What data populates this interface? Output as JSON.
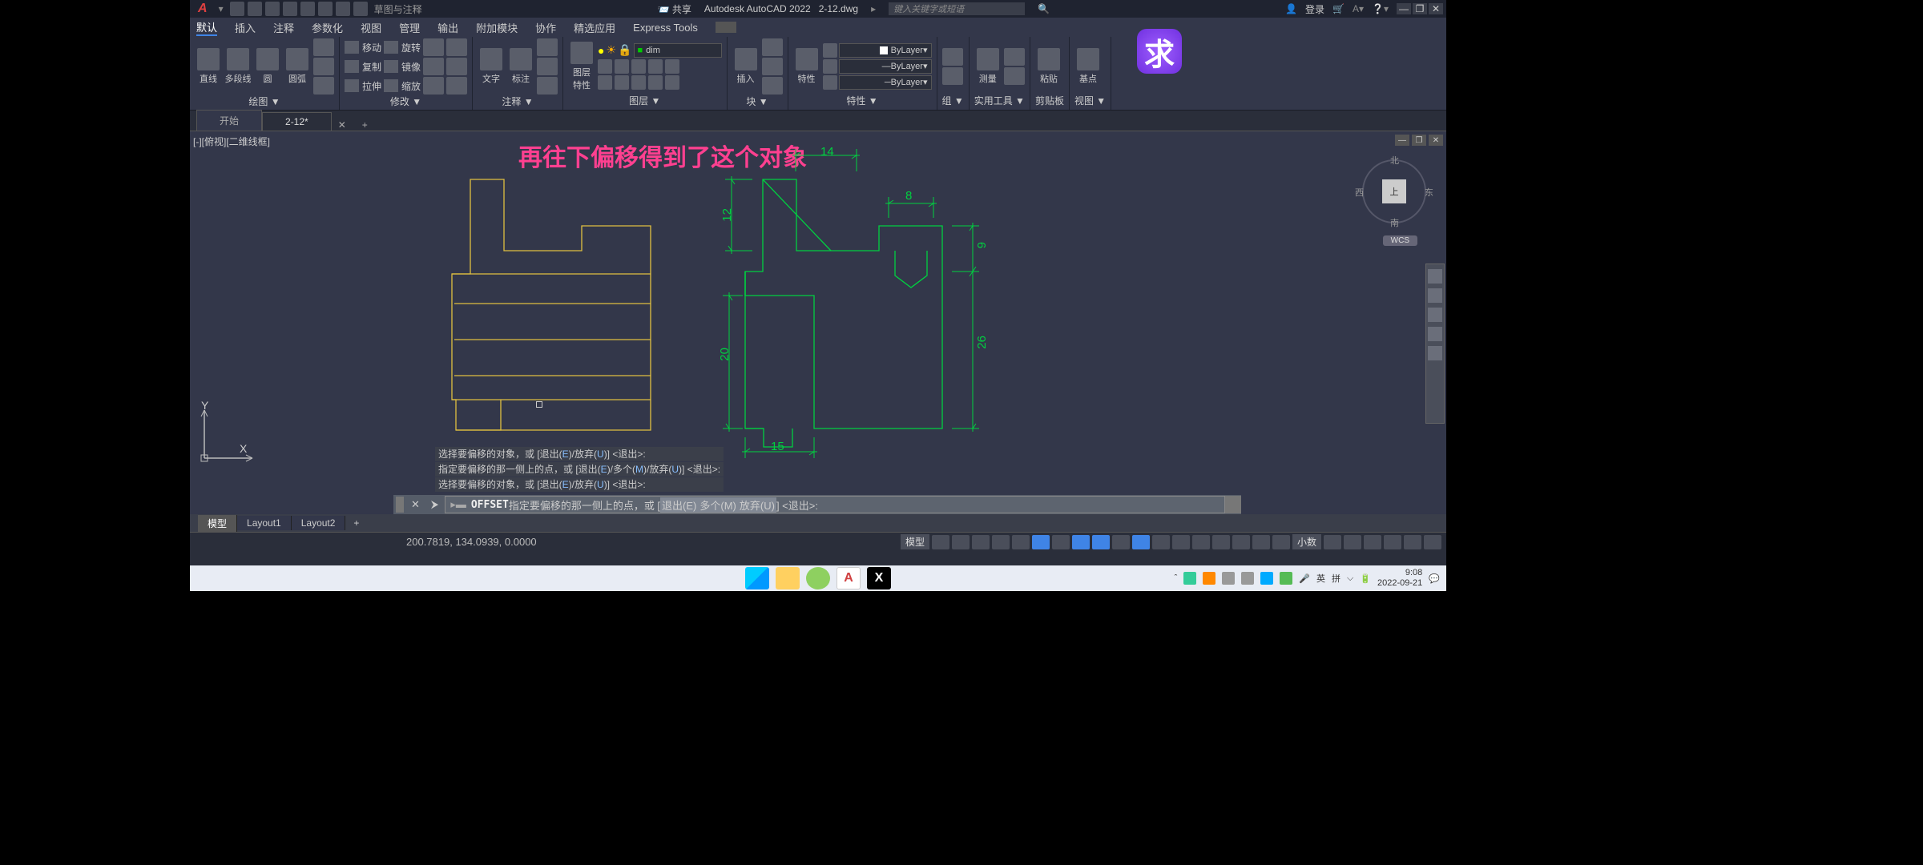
{
  "titlebar": {
    "logo": "A",
    "workspace": "草图与注释",
    "share": "共享",
    "app_title": "Autodesk AutoCAD 2022",
    "filename": "2-12.dwg",
    "search_placeholder": "键入关键字或短语",
    "login": "登录",
    "min": "—",
    "max": "❐",
    "close": "✕"
  },
  "ribbon_tabs": {
    "t0": "默认",
    "t1": "插入",
    "t2": "注释",
    "t3": "参数化",
    "t4": "视图",
    "t5": "管理",
    "t6": "输出",
    "t7": "附加模块",
    "t8": "协作",
    "t9": "精选应用",
    "t10": "Express Tools"
  },
  "panels": {
    "draw": {
      "label": "绘图 ▼",
      "line": "直线",
      "polyline": "多段线",
      "circle": "圆",
      "arc": "圆弧"
    },
    "modify": {
      "label": "修改 ▼",
      "move": "移动",
      "copy": "复制",
      "stretch": "拉伸",
      "rotate": "旋转",
      "mirror": "镜像",
      "scale": "缩放"
    },
    "annot": {
      "label": "注释 ▼",
      "text": "文字",
      "dim": "标注"
    },
    "layer": {
      "label": "图层 ▼",
      "props": "图层\n特性",
      "current": "dim"
    },
    "block": {
      "label": "块 ▼",
      "insert": "插入"
    },
    "props": {
      "label": "特性 ▼",
      "btn": "特性",
      "color": "ByLayer",
      "lweight": "ByLayer",
      "ltype": "ByLayer"
    },
    "group": {
      "label": "组 ▼"
    },
    "util": {
      "label": "实用工具 ▼",
      "measure": "测量"
    },
    "clip": {
      "label": "剪贴板",
      "paste": "粘贴"
    },
    "view": {
      "label": "视图 ▼",
      "base": "基点"
    }
  },
  "doc_tabs": {
    "start": "开始",
    "active": "2-12*",
    "close": "✕",
    "plus": "+"
  },
  "viewport": {
    "label": "[-][俯视][二维线框]",
    "min": "—",
    "max": "❐",
    "close": "✕"
  },
  "annotation": "再往下偏移得到了这个对象",
  "viewcube": {
    "top": "上",
    "n": "北",
    "s": "南",
    "e": "东",
    "w": "西",
    "wcs": "WCS"
  },
  "dims": {
    "d14": "14",
    "d8": "8",
    "d12": "12",
    "d9": "9",
    "d20": "20",
    "d26": "26",
    "d15": "15"
  },
  "ucs": {
    "x": "X",
    "y": "Y"
  },
  "cmd_history": {
    "l1_a": "选择要偏移的对象，或 [退出(",
    "l1_b": ")/放弃(",
    "l1_c": ")] <退出>:",
    "l2_a": "指定要偏移的那一侧上的点，或 [退出(",
    "l2_b": ")/多个(",
    "l2_c": ")/放弃(",
    "l2_d": ")] <退出>:",
    "l3_a": "选择要偏移的对象，或 [退出(",
    "l3_b": ")/放弃(",
    "l3_c": ")] <退出>:",
    "E": "E",
    "U": "U",
    "M": "M"
  },
  "cmd": {
    "close": "✕",
    "arrow": "⮞",
    "prefix": "▸▬",
    "name": "OFFSET",
    "text_a": " 指定要偏移的那一侧上的点，或 [",
    "opt1": "退出(E)",
    "sep1": " ",
    "opt2": "多个(M)",
    "sep2": " ",
    "opt3": "放弃(U)",
    "text_b": "] <退出>:"
  },
  "layout_tabs": {
    "model": "模型",
    "l1": "Layout1",
    "l2": "Layout2",
    "plus": "+"
  },
  "status": {
    "coords": "200.7819, 134.0939, 0.0000",
    "model": "模型",
    "dec": "小数"
  },
  "taskbar": {
    "cad_icon": "A",
    "cap_icon": "X",
    "ime1": "英",
    "ime2": "拼",
    "time": "9:08",
    "date": "2022-09-21"
  },
  "qiu": "求"
}
